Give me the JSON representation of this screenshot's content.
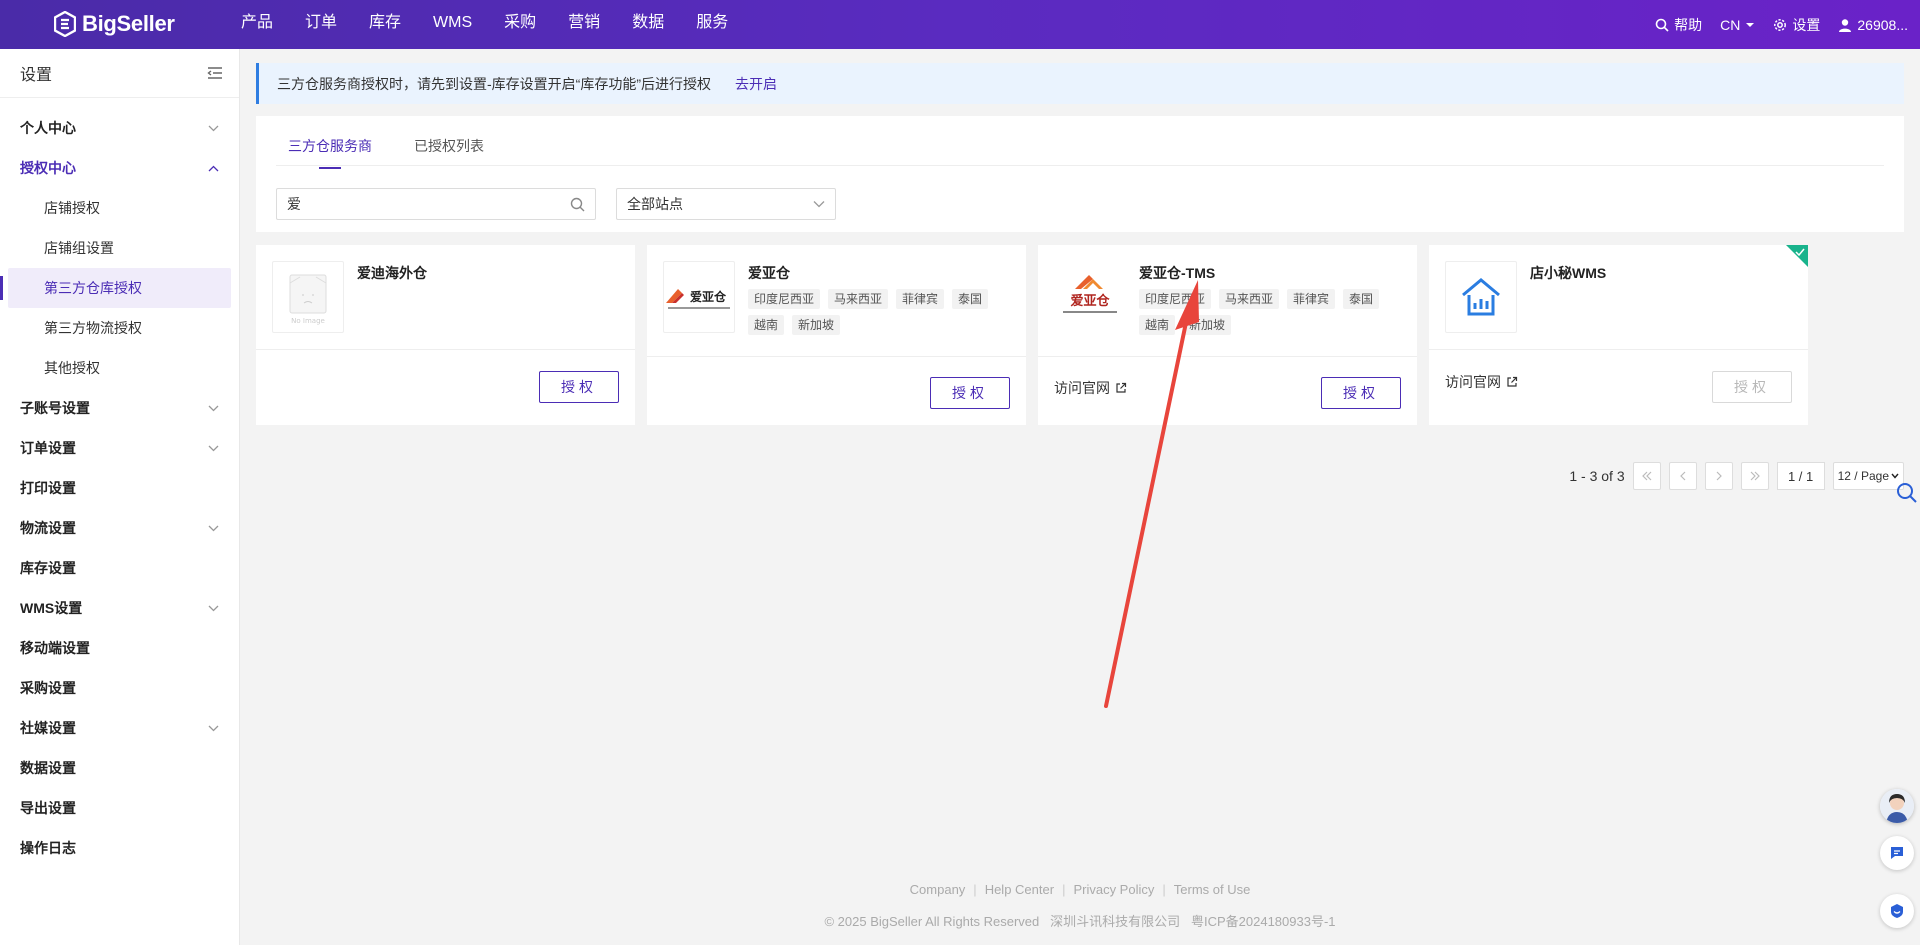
{
  "app": {
    "brand": "BigSeller",
    "nav": [
      "产品",
      "订单",
      "库存",
      "WMS",
      "采购",
      "营销",
      "数据",
      "服务"
    ],
    "right": {
      "help": "帮助",
      "lang": "CN",
      "settings": "设置",
      "user": "26908..."
    }
  },
  "sidebar": {
    "title": "设置",
    "items": [
      {
        "label": "个人中心",
        "chevron": "down"
      },
      {
        "label": "授权中心",
        "chevron": "up",
        "active": true
      },
      {
        "label": "店铺授权",
        "sub": true
      },
      {
        "label": "店铺组设置",
        "sub": true
      },
      {
        "label": "第三方仓库授权",
        "sub": true,
        "selected": true
      },
      {
        "label": "第三方物流授权",
        "sub": true
      },
      {
        "label": "其他授权",
        "sub": true
      },
      {
        "label": "子账号设置",
        "chevron": "down"
      },
      {
        "label": "订单设置",
        "chevron": "down"
      },
      {
        "label": "打印设置"
      },
      {
        "label": "物流设置",
        "chevron": "down"
      },
      {
        "label": "库存设置"
      },
      {
        "label": "WMS设置",
        "chevron": "down"
      },
      {
        "label": "移动端设置"
      },
      {
        "label": "采购设置"
      },
      {
        "label": "社媒设置",
        "chevron": "down"
      },
      {
        "label": "数据设置"
      },
      {
        "label": "导出设置"
      },
      {
        "label": "操作日志"
      }
    ]
  },
  "notice": {
    "text": "三方仓服务商授权时，请先到设置-库存设置开启“库存功能”后进行授权",
    "link": "去开启"
  },
  "tabs": [
    "三方仓服务商",
    "已授权列表"
  ],
  "search": {
    "value": "爱",
    "placeholder": ""
  },
  "site_select": {
    "value": "全部站点"
  },
  "cards": [
    {
      "name": "爱迪海外仓",
      "logo": "no-image",
      "no_image_text": "No Image",
      "tags": [],
      "site_link": "",
      "button": "授权",
      "disabled": false
    },
    {
      "name": "爱亚仓",
      "logo": "aiyacang",
      "logo_text": "爱亚仓",
      "tags": [
        "印度尼西亚",
        "马来西亚",
        "菲律宾",
        "泰国",
        "越南",
        "新加坡"
      ],
      "site_link": "",
      "button": "授权",
      "disabled": false
    },
    {
      "name": "爱亚仓-TMS",
      "logo": "aiyacang-tms",
      "logo_text": "爱亚仓",
      "tags": [
        "印度尼西亚",
        "马来西亚",
        "菲律宾",
        "泰国",
        "越南",
        "新加坡"
      ],
      "site_link": "访问官网",
      "button": "授权",
      "disabled": false
    },
    {
      "name": "店小秘WMS",
      "logo": "dianxiaomi",
      "tags": [],
      "site_link": "访问官网",
      "button": "授权",
      "disabled": true,
      "authorized": true
    }
  ],
  "pagination": {
    "range": "1 - 3 of 3",
    "page": "1 / 1",
    "page_size": "12 / Page"
  },
  "footer": {
    "links": [
      "Company",
      "Help Center",
      "Privacy Policy",
      "Terms of Use"
    ],
    "copyright": "© 2025 BigSeller All Rights Reserved",
    "company": "深圳斗讯科技有限公司",
    "icp": "粤ICP备2024180933号-1"
  },
  "colors": {
    "brand": "#5a2bc0",
    "accent": "#4b2db5",
    "annotation_arrow": "#e8453c",
    "authorized": "#19b38c"
  }
}
